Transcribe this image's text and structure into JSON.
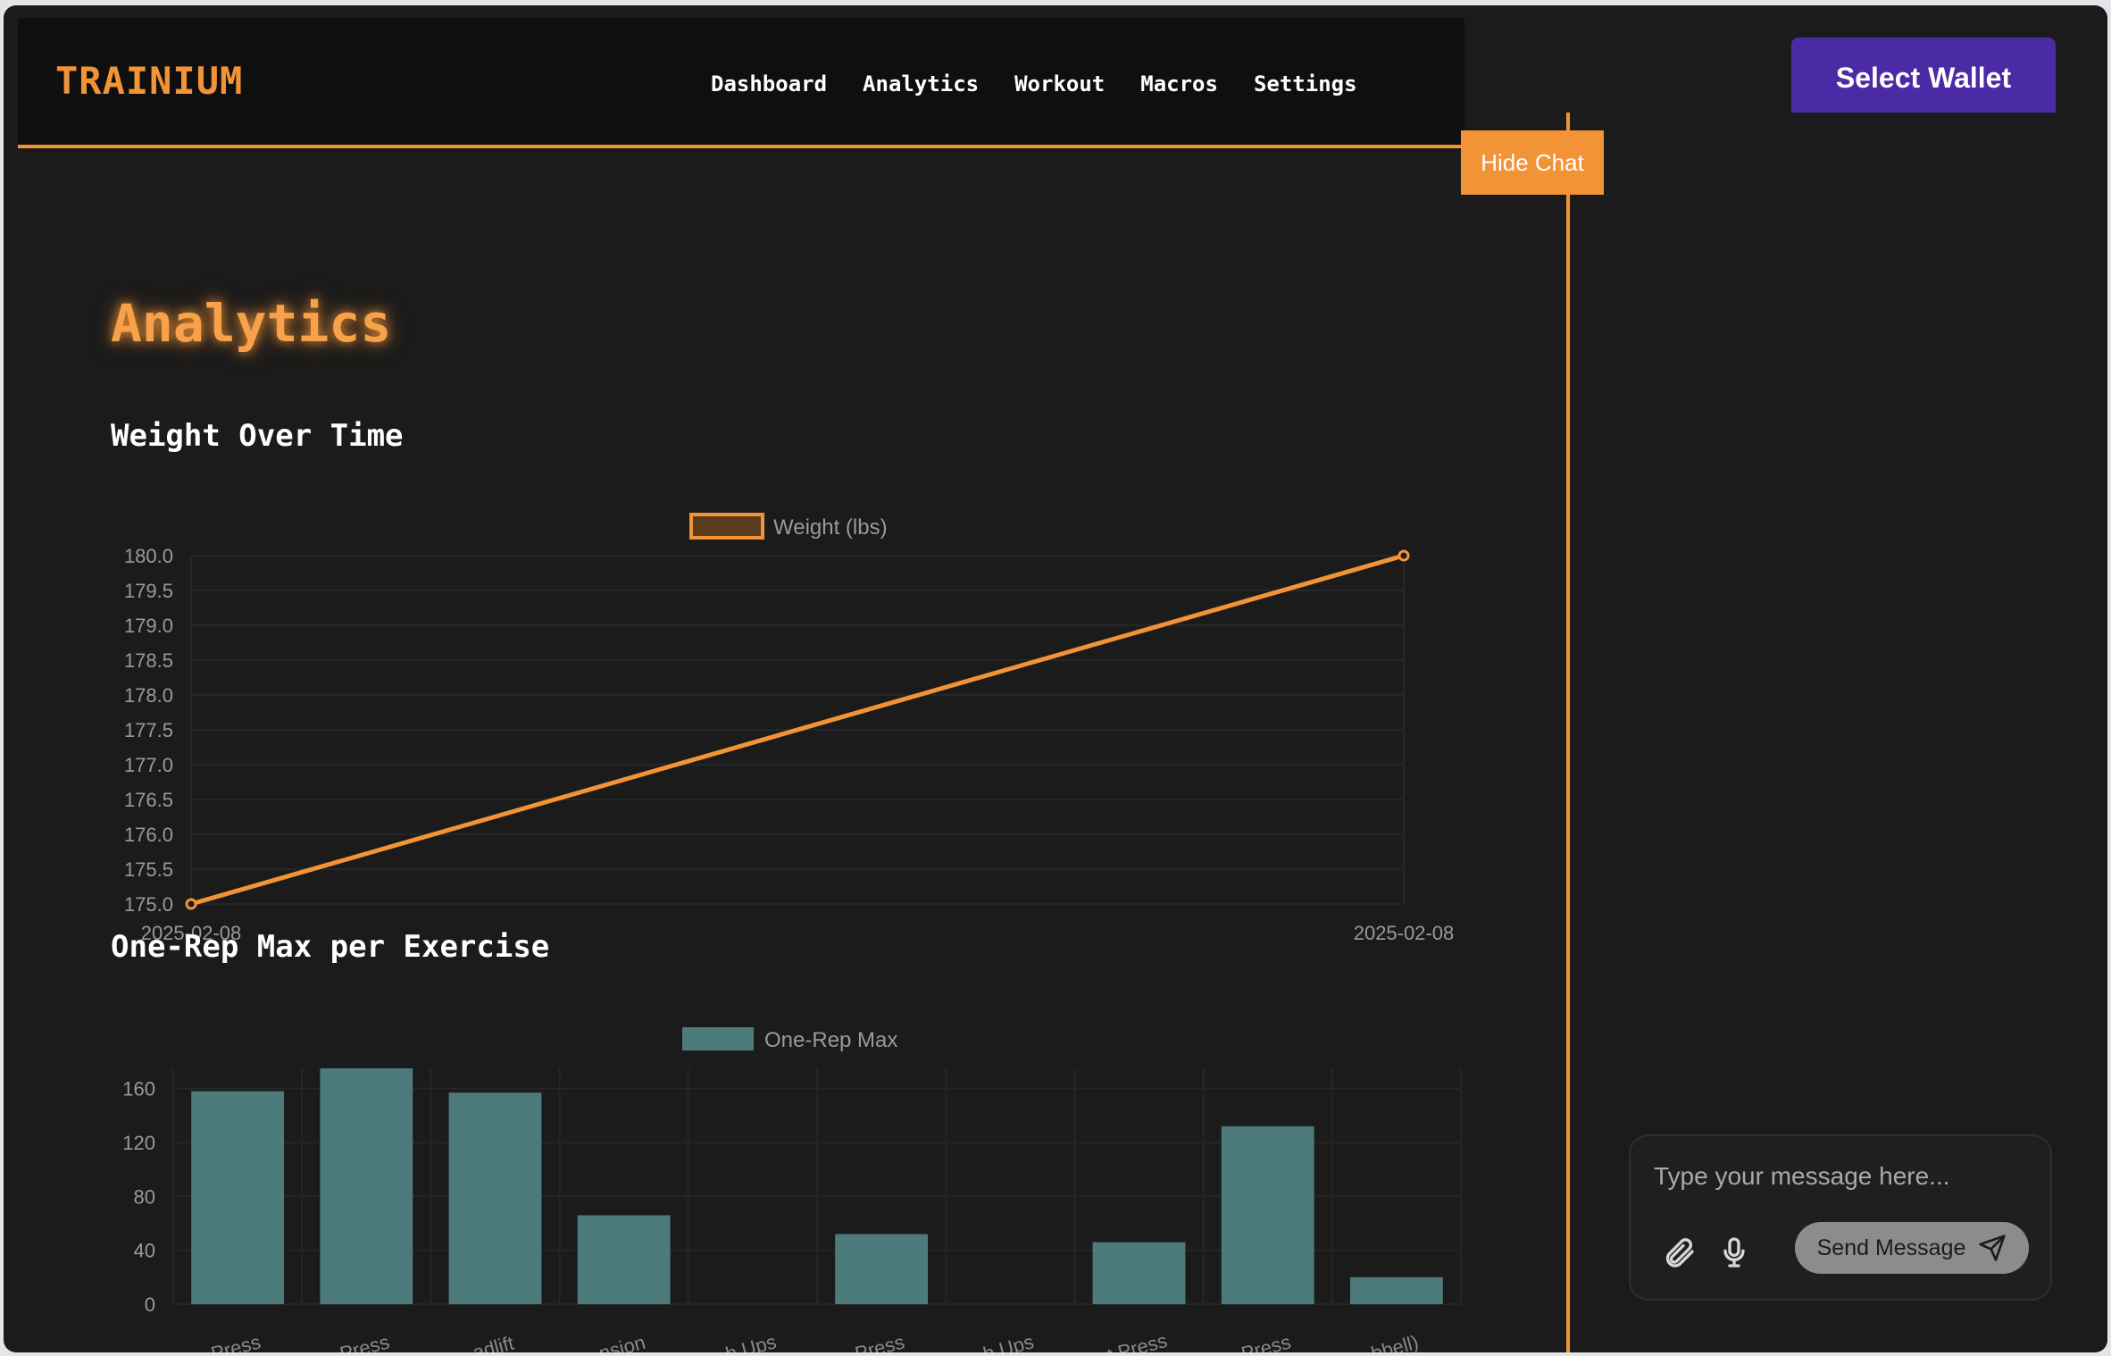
{
  "brand": {
    "logo": "TRAINIUM",
    "accent": "#f29336"
  },
  "nav": {
    "items": [
      "Dashboard",
      "Analytics",
      "Workout",
      "Macros",
      "Settings"
    ]
  },
  "header": {
    "wallet_label": "Select Wallet"
  },
  "chat": {
    "toggle_label": "Hide Chat",
    "placeholder": "Type your message here...",
    "send_label": "Send Message",
    "icons": [
      "paperclip-icon",
      "microphone-icon",
      "send-icon"
    ]
  },
  "page": {
    "title": "Analytics"
  },
  "sections": {
    "weight_title": "Weight Over Time",
    "orm_title": "One-Rep Max per Exercise"
  },
  "chart_data": [
    {
      "type": "line",
      "x": [
        "2025-02-08",
        "2025-02-08"
      ],
      "series": [
        {
          "name": "Weight (lbs)",
          "values": [
            175.0,
            180.0
          ],
          "color": "#f29336"
        }
      ],
      "ylim": [
        175.0,
        180.0
      ],
      "yticks": [
        "180.0",
        "179.5",
        "179.0",
        "178.5",
        "178.0",
        "177.5",
        "177.0",
        "176.5",
        "176.0",
        "175.5",
        "175.0"
      ],
      "legend": "top-center",
      "grid": true
    },
    {
      "type": "bar",
      "categories": [
        "Press",
        "Press",
        "adlift",
        "nsion",
        "h Ups",
        "Press",
        "h Ups",
        "t Press",
        "Press",
        "bbell)"
      ],
      "series": [
        {
          "name": "One-Rep Max",
          "values": [
            158,
            175,
            157,
            66,
            0,
            52,
            0,
            46,
            132,
            20
          ],
          "color": "#4d7b7b"
        }
      ],
      "ylim": [
        0,
        175
      ],
      "yticks": [
        "160",
        "120",
        "80",
        "40",
        "0"
      ],
      "legend": "top-center",
      "grid": true
    }
  ]
}
